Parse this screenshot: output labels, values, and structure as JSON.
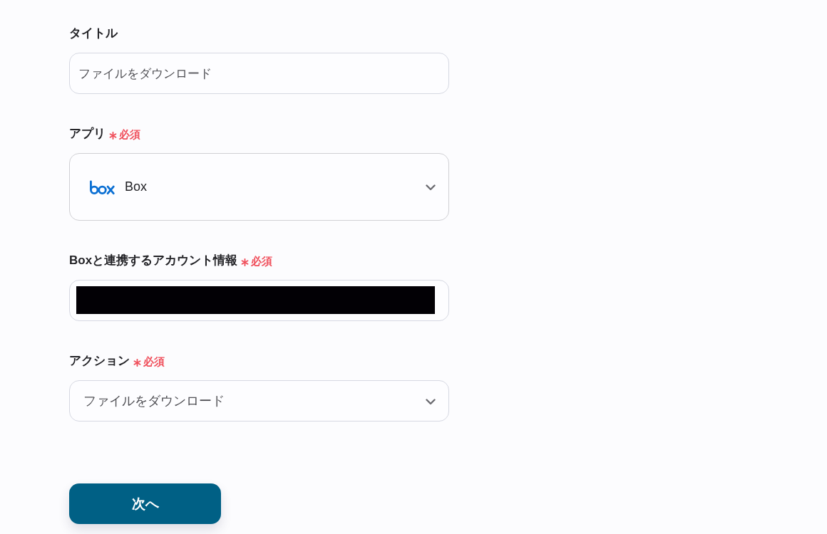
{
  "fields": [
    {
      "kind": "text",
      "label": "タイトル",
      "required": false,
      "value": "ファイルをダウンロード"
    },
    {
      "kind": "app_select",
      "label": "アプリ",
      "required": true,
      "required_label": "必須",
      "value": "Box"
    },
    {
      "kind": "account",
      "label": "Boxと連携するアカウント情報",
      "required": true,
      "required_label": "必須",
      "redacted": true
    },
    {
      "kind": "select",
      "label": "アクション",
      "required": true,
      "required_label": "必須",
      "value": "ファイルをダウンロード"
    }
  ],
  "next_button": "次へ"
}
